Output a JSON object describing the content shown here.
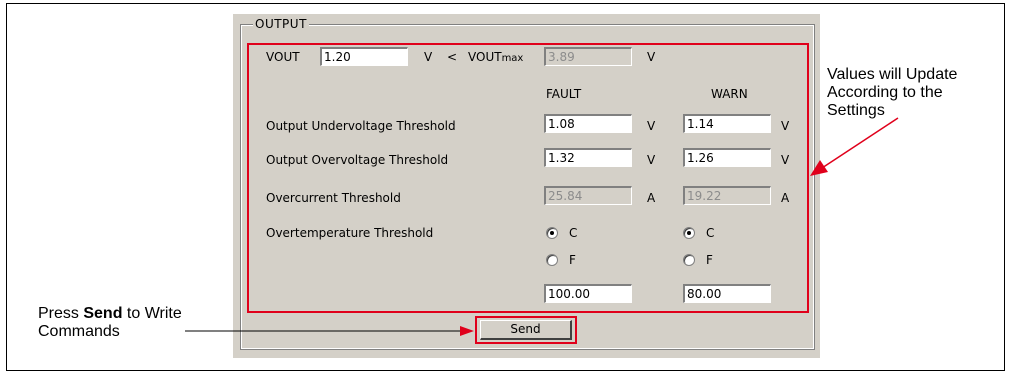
{
  "group_title": "OUTPUT",
  "vout": {
    "label": "VOUT",
    "value": "1.20",
    "unit": "V",
    "compare": "<",
    "max_label": "VOUT",
    "max_sub": "max",
    "max_value": "3.89",
    "max_unit": "V"
  },
  "columns": {
    "fault": "FAULT",
    "warn": "WARN"
  },
  "rows": [
    {
      "label": "Output Undervoltage Threshold",
      "fault": "1.08",
      "fault_unit": "V",
      "warn": "1.14",
      "warn_unit": "V"
    },
    {
      "label": "Output Overvoltage Threshold",
      "fault": "1.32",
      "fault_unit": "V",
      "warn": "1.26",
      "warn_unit": "V"
    },
    {
      "label": "Overcurrent Threshold",
      "fault": "25.84",
      "fault_unit": "A",
      "warn": "19.22",
      "warn_unit": "A"
    }
  ],
  "overtemp": {
    "label": "Overtemperature Threshold",
    "option_c": "C",
    "option_f": "F",
    "fault_selected": "C",
    "warn_selected": "C",
    "fault_value": "100.00",
    "warn_value": "80.00"
  },
  "send_label": "Send",
  "annotations": {
    "right_note": [
      "Values will Update",
      "According to the",
      "Settings"
    ],
    "left_note_pre": "Press ",
    "left_note_bold": "Send",
    "left_note_post": " to Write",
    "left_note_line2": "Commands"
  },
  "colors": {
    "highlight": "#e0001b",
    "panel": "#d4d0c8"
  }
}
